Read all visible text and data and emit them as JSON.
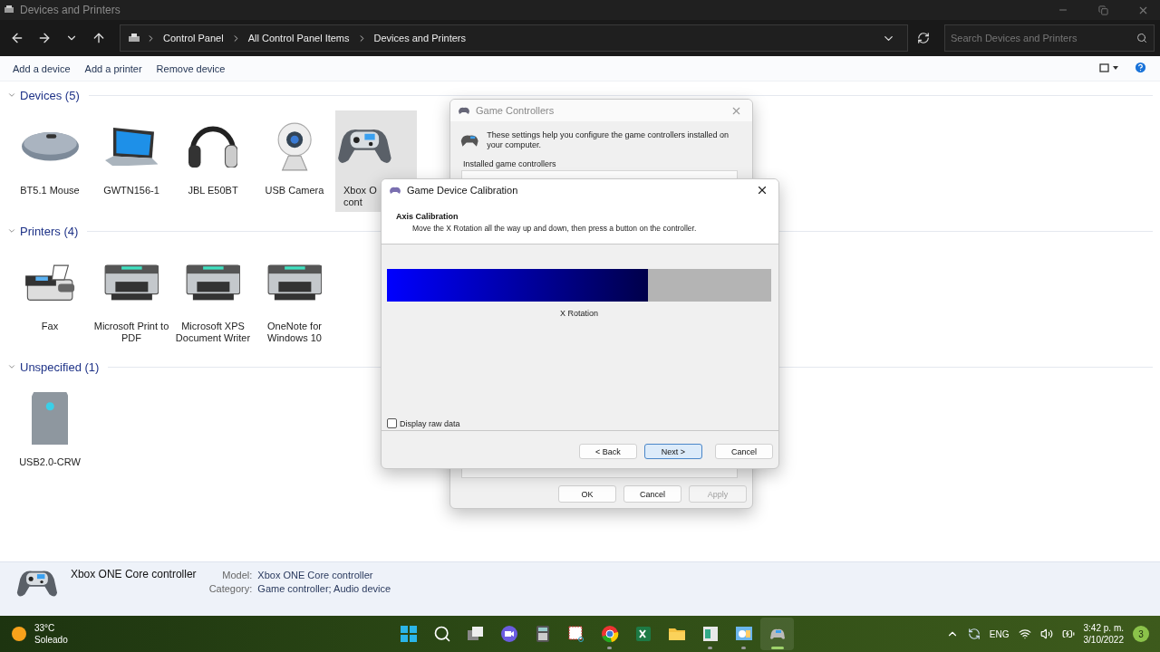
{
  "window": {
    "title": "Devices and Printers"
  },
  "address": {
    "crumbs": [
      "Control Panel",
      "All Control Panel Items",
      "Devices and Printers"
    ]
  },
  "search": {
    "placeholder": "Search Devices and Printers"
  },
  "commands": [
    "Add a device",
    "Add a printer",
    "Remove device"
  ],
  "groups": [
    {
      "title": "Devices (5)",
      "expanded": true,
      "items": [
        {
          "lines": [
            "BT5.1 Mouse"
          ],
          "selected": false
        },
        {
          "lines": [
            "GWTN156-1"
          ],
          "selected": false
        },
        {
          "lines": [
            "JBL E50BT"
          ],
          "selected": false
        },
        {
          "lines": [
            "USB Camera"
          ],
          "selected": false
        },
        {
          "lines": [
            "Xbox O",
            "cont"
          ],
          "selected": true,
          "cut": true
        }
      ]
    },
    {
      "title": "Printers (4)",
      "expanded": true,
      "items": [
        {
          "lines": [
            "Fax"
          ],
          "selected": false
        },
        {
          "lines": [
            "Microsoft Print to",
            "PDF"
          ],
          "selected": false
        },
        {
          "lines": [
            "Microsoft XPS",
            "Document Writer"
          ],
          "selected": false
        },
        {
          "lines": [
            "OneNote for",
            "Windows 10"
          ],
          "selected": false
        }
      ]
    },
    {
      "title": "Unspecified (1)",
      "expanded": true,
      "items": [
        {
          "lines": [
            "USB2.0-CRW"
          ],
          "selected": false
        }
      ]
    }
  ],
  "game_controllers": {
    "title": "Game Controllers",
    "intro": "These settings help you configure the game controllers installed on your computer.",
    "list_label": "Installed game controllers",
    "buttons": [
      {
        "label": "OK",
        "disabled": false
      },
      {
        "label": "Cancel",
        "disabled": false
      },
      {
        "label": "Apply",
        "disabled": true
      }
    ]
  },
  "calibration": {
    "title": "Game Device Calibration",
    "heading": "Axis Calibration",
    "instruction": "Move the X Rotation all the way up and down, then press a button on the controller.",
    "axis": {
      "label": "X Rotation",
      "level": 0.68
    },
    "raw_data": {
      "label": "Display raw data",
      "checked": false
    },
    "buttons": [
      {
        "label": "< Back",
        "default": false
      },
      {
        "label": "Next >",
        "default": true
      },
      {
        "label": "Cancel",
        "default": false
      }
    ]
  },
  "details": {
    "name": "Xbox ONE Core controller",
    "fields": [
      {
        "label": "Model:",
        "value": "Xbox ONE Core controller"
      },
      {
        "label": "Category:",
        "value": "Game controller; Audio device"
      }
    ]
  },
  "taskbar": {
    "weather": {
      "temp": "33°C",
      "condition": "Soleado"
    },
    "apps": [
      {
        "running": false,
        "active": false
      },
      {
        "running": false,
        "active": false
      },
      {
        "running": false,
        "active": false
      },
      {
        "running": false,
        "active": false
      },
      {
        "running": false,
        "active": false
      },
      {
        "running": false,
        "active": false
      },
      {
        "running": true,
        "active": false
      },
      {
        "running": false,
        "active": false
      },
      {
        "running": false,
        "active": false
      },
      {
        "running": true,
        "active": false
      },
      {
        "running": true,
        "active": false
      },
      {
        "running": true,
        "active": true
      }
    ],
    "tray": {
      "language": "ENG",
      "time": "3:42 p. m.",
      "date": "3/10/2022",
      "notifications": "3"
    }
  }
}
